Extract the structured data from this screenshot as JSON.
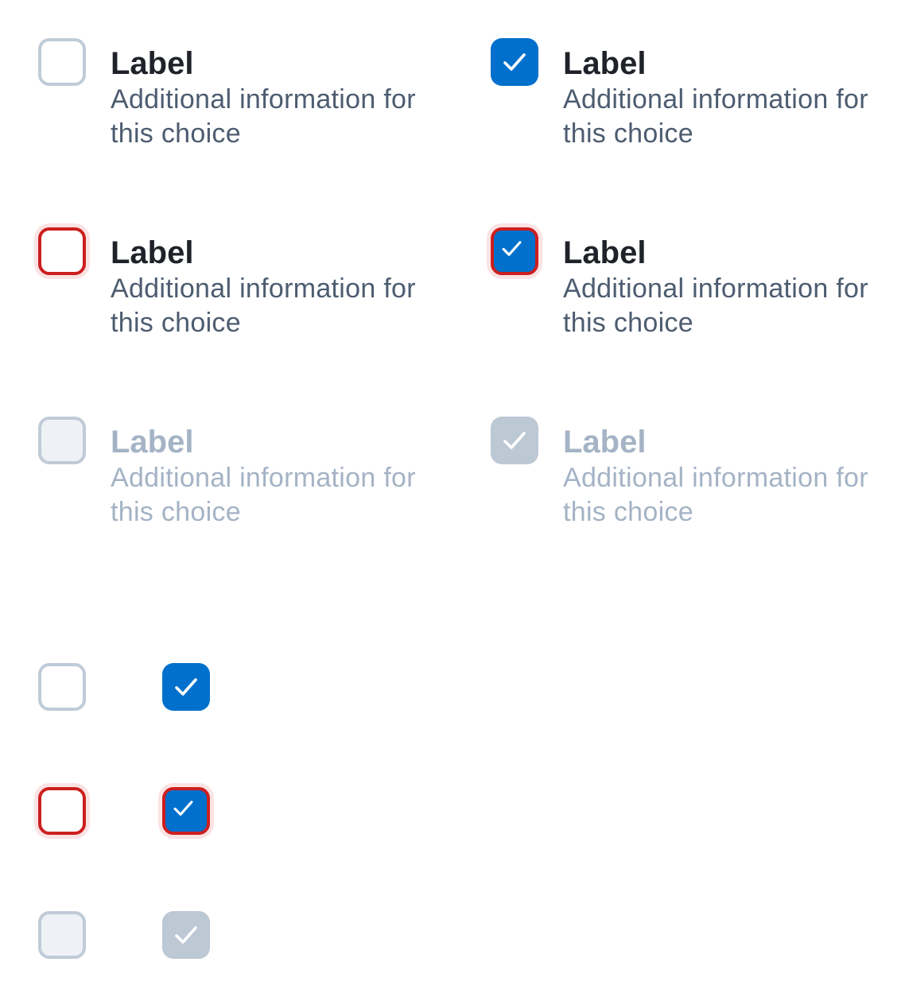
{
  "options": [
    {
      "label": "Label",
      "description": "Additional information for this choice"
    },
    {
      "label": "Label",
      "description": "Additional information for this choice"
    },
    {
      "label": "Label",
      "description": "Additional information for this choice"
    },
    {
      "label": "Label",
      "description": "Additional information for this choice"
    },
    {
      "label": "Label",
      "description": "Additional information for this choice"
    },
    {
      "label": "Label",
      "description": "Additional information for this choice"
    }
  ],
  "colors": {
    "checked_fill": "#0070cc",
    "default_border": "#c0cbd8",
    "error_border": "#cc1f1f",
    "error_halo": "#fbe3e3",
    "disabled_fill": "#eef1f5",
    "disabled_checked_fill": "#bdc8d5",
    "label_text": "#1f2329",
    "description_text": "#4d5c70",
    "disabled_text": "#a4b3c5"
  },
  "icons": {
    "check": "check-icon"
  }
}
